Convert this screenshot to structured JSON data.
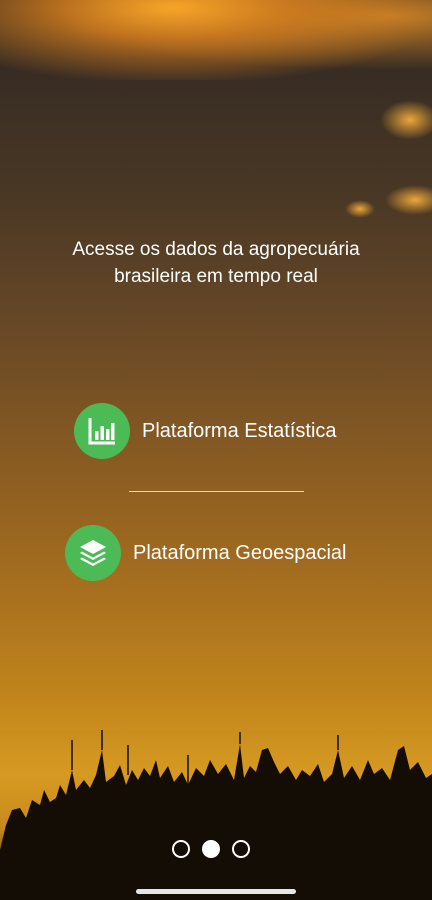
{
  "headline": "Acesse os dados da agropecuária brasileira em tempo real",
  "platforms": [
    {
      "label": "Plataforma Estatística",
      "icon": "bar-chart-icon"
    },
    {
      "label": "Plataforma Geoespacial",
      "icon": "layers-icon"
    }
  ],
  "pager": {
    "total": 3,
    "active_index": 1
  },
  "colors": {
    "accent": "#4cbb55",
    "text": "#ffffff"
  }
}
